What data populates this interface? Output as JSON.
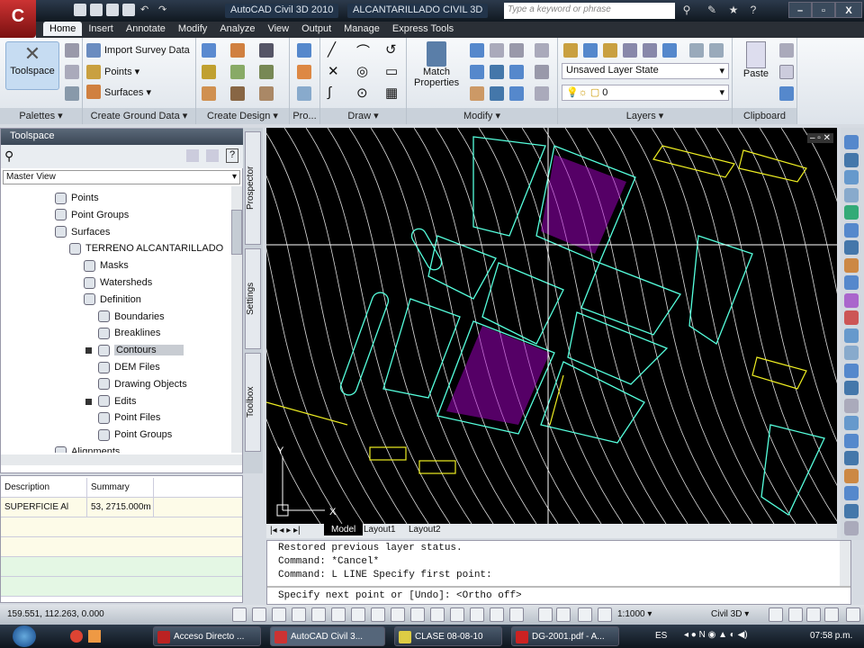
{
  "title": {
    "app": "AutoCAD Civil 3D 2010",
    "file": "ALCANTARILLADO CIVIL 3D",
    "search_placeholder": "Type a keyword or phrase",
    "app_letter": "C"
  },
  "tabs": [
    "Home",
    "Insert",
    "Annotate",
    "Modify",
    "Analyze",
    "View",
    "Output",
    "Manage",
    "Express Tools"
  ],
  "ribbon": {
    "toolspace": "Toolspace",
    "import_survey": "Import Survey Data",
    "points": "Points ▾",
    "surfaces": "Surfaces ▾",
    "match": "Match",
    "properties": "Properties",
    "layer_state": "Unsaved Layer State",
    "layer_current": "0",
    "paste": "Paste",
    "panels": [
      "Palettes ▾",
      "Create Ground Data ▾",
      "Create Design ▾",
      "Pro...",
      "Draw ▾",
      "Modify ▾",
      "Layers ▾",
      "Clipboard"
    ]
  },
  "toolspace": {
    "title": "Toolspace",
    "view": "Master View",
    "tree": [
      {
        "label": "Points",
        "level": 3
      },
      {
        "label": "Point Groups",
        "level": 3
      },
      {
        "label": "Surfaces",
        "level": 3
      },
      {
        "label": "TERRENO ALCANTARILLADO",
        "level": 4
      },
      {
        "label": "Masks",
        "level": 5
      },
      {
        "label": "Watersheds",
        "level": 5
      },
      {
        "label": "Definition",
        "level": 5
      },
      {
        "label": "Boundaries",
        "level": 6
      },
      {
        "label": "Breaklines",
        "level": 6
      },
      {
        "label": "Contours",
        "level": 6,
        "selected": true
      },
      {
        "label": "DEM Files",
        "level": 6
      },
      {
        "label": "Drawing Objects",
        "level": 6
      },
      {
        "label": "Edits",
        "level": 6
      },
      {
        "label": "Point Files",
        "level": 6
      },
      {
        "label": "Point Groups",
        "level": 6
      },
      {
        "label": "Alignments",
        "level": 3
      }
    ],
    "side_tabs": [
      "Prospector",
      "Settings",
      "Toolbox"
    ]
  },
  "properties": {
    "headers": [
      "Description",
      "Summary"
    ],
    "rows": [
      [
        "SUPERFICIE Al",
        "53, 2715.000m"
      ]
    ]
  },
  "drawing": {
    "layout_tabs": [
      "Model",
      "Layout1",
      "Layout2"
    ],
    "axis_x": "X",
    "axis_y": "Y"
  },
  "command": {
    "lines": [
      "Restored previous layer status.",
      "Command: *Cancel*",
      "Command: L LINE Specify first point:"
    ],
    "prompt": "Specify next point or [Undo]:  <Ortho off>"
  },
  "status": {
    "coords": "159.551, 112.263, 0.000",
    "scale": "1:1000 ▾",
    "workspace": "Civil 3D ▾"
  },
  "taskbar": {
    "items": [
      "Acceso Directo ...",
      "AutoCAD Civil 3...",
      "CLASE 08-08-10",
      "DG-2001.pdf - A..."
    ],
    "lang": "ES",
    "clock": "07:58 p.m."
  }
}
